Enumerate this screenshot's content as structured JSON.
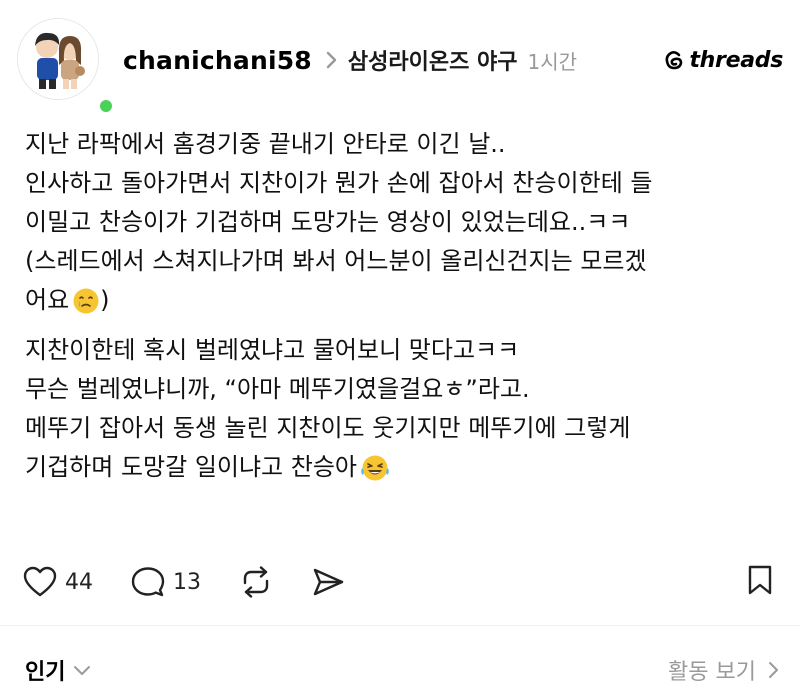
{
  "author": {
    "username": "chanichani58",
    "topic": "삼성라이온즈 야구",
    "time": "1시간",
    "online": true
  },
  "brand": {
    "name": "threads"
  },
  "post": {
    "lines": [
      "지난 라팍에서 홈경기중 끝내기 안타로 이긴 날..",
      "인사하고 돌아가면서 지찬이가 뭔가 손에 잡아서 찬승이한테 들",
      "이밀고 찬승이가 기겁하며 도망가는 영상이 있었는데요..ㅋㅋ",
      "(스레드에서 스쳐지나가며 봐서 어느분이 올리신건지는 모르겠",
      "어요",
      ")",
      "지찬이한테 혹시 벌레였냐고 물어보니 맞다고ㅋㅋ",
      "무슨 벌레였냐니까, “아마 메뚜기였을걸요ㅎ”라고.",
      "메뚜기 잡아서 동생 놀린 지찬이도 웃기지만 메뚜기에 그렇게",
      "기겁하며 도망갈 일이냐고 찬승아"
    ]
  },
  "actions": {
    "like_count": "44",
    "comment_count": "13"
  },
  "footer": {
    "sort_label": "인기",
    "activity_label": "활동 보기"
  },
  "icons": {
    "brand_logo": "threads-logo-icon",
    "like": "heart-icon",
    "comment": "comment-bubble-icon",
    "repost": "repost-icon",
    "share": "send-icon",
    "save": "bookmark-icon",
    "emoji_1": "sad-tear-emoji-icon",
    "emoji_2": "laughing-tears-emoji-icon"
  },
  "colors": {
    "online": "#4ad15a",
    "muted": "#999999",
    "text": "#111111"
  }
}
